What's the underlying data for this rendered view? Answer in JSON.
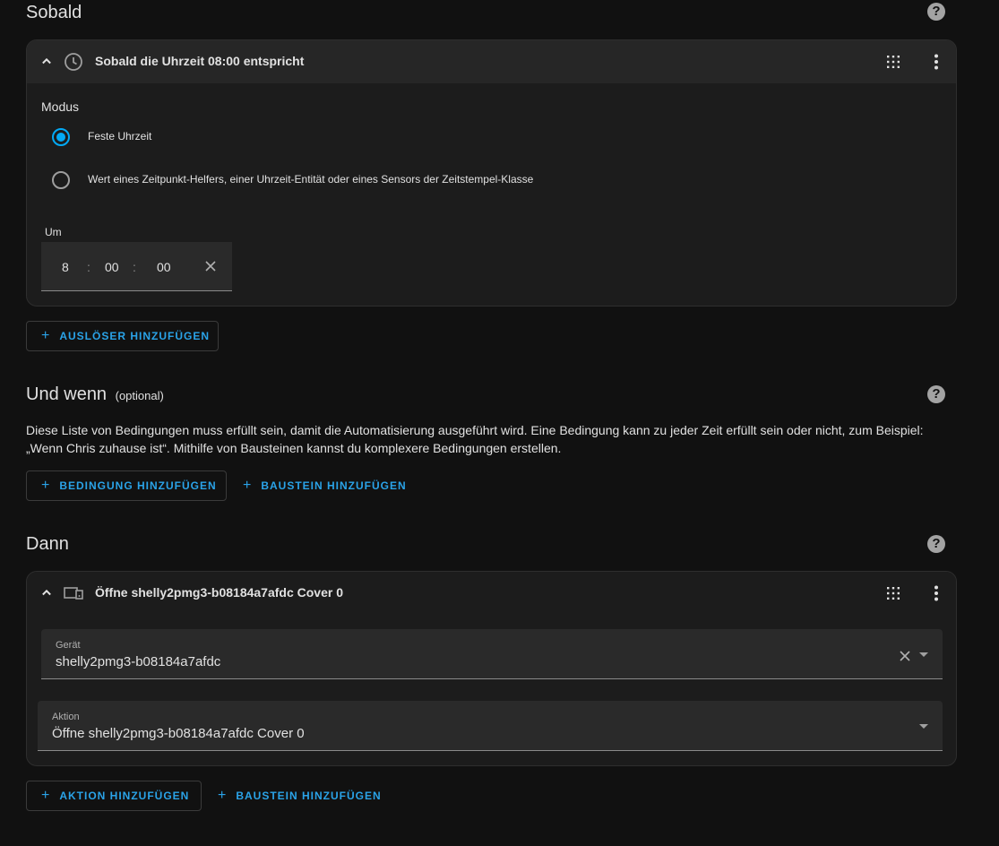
{
  "trigger_section": {
    "title": "Sobald",
    "card_title": "Sobald die Uhrzeit 08:00 entspricht",
    "mode_label": "Modus",
    "options": [
      {
        "label": "Feste Uhrzeit",
        "checked": true
      },
      {
        "label": "Wert eines Zeitpunkt-Helfers, einer Uhrzeit-Entität oder eines Sensors der Zeitstempel-Klasse",
        "checked": false
      }
    ],
    "time_label": "Um",
    "hours": "8",
    "minutes": "00",
    "seconds": "00",
    "separator": ":",
    "add_button": "AUSLÖSER HINZUFÜGEN"
  },
  "condition_section": {
    "title": "Und wenn",
    "optional": "(optional)",
    "description": "Diese Liste von Bedingungen muss erfüllt sein, damit die Automatisierung ausgeführt wird. Eine Bedingung kann zu jeder Zeit erfüllt sein oder nicht, zum Beispiel: „Wenn Chris zuhause ist“. Mithilfe von Bausteinen kannst du komplexere Bedingungen erstellen.",
    "add_condition_button": "BEDINGUNG HINZUFÜGEN",
    "add_block_button": "BAUSTEIN HINZUFÜGEN"
  },
  "action_section": {
    "title": "Dann",
    "card_title": "Öffne shelly2pmg3-b08184a7afdc Cover 0",
    "device_label": "Gerät",
    "device_value": "shelly2pmg3-b08184a7afdc",
    "action_label": "Aktion",
    "action_value": "Öffne shelly2pmg3-b08184a7afdc Cover 0",
    "add_action_button": "AKTION HINZUFÜGEN",
    "add_block_button": "BAUSTEIN HINZUFÜGEN"
  },
  "help_glyph": "?",
  "plus_glyph": "+",
  "colors": {
    "background": "#111111",
    "card": "#1c1c1c",
    "card_header": "#262626",
    "accent": "#03a9f4",
    "button_text": "#2aa3e8"
  },
  "icons": [
    "help-icon",
    "chevron-up-icon",
    "clock-icon",
    "drag-handle-icon",
    "more-vert-icon",
    "close-icon",
    "dropdown-arrow-icon",
    "device-icon",
    "plus-icon"
  ]
}
